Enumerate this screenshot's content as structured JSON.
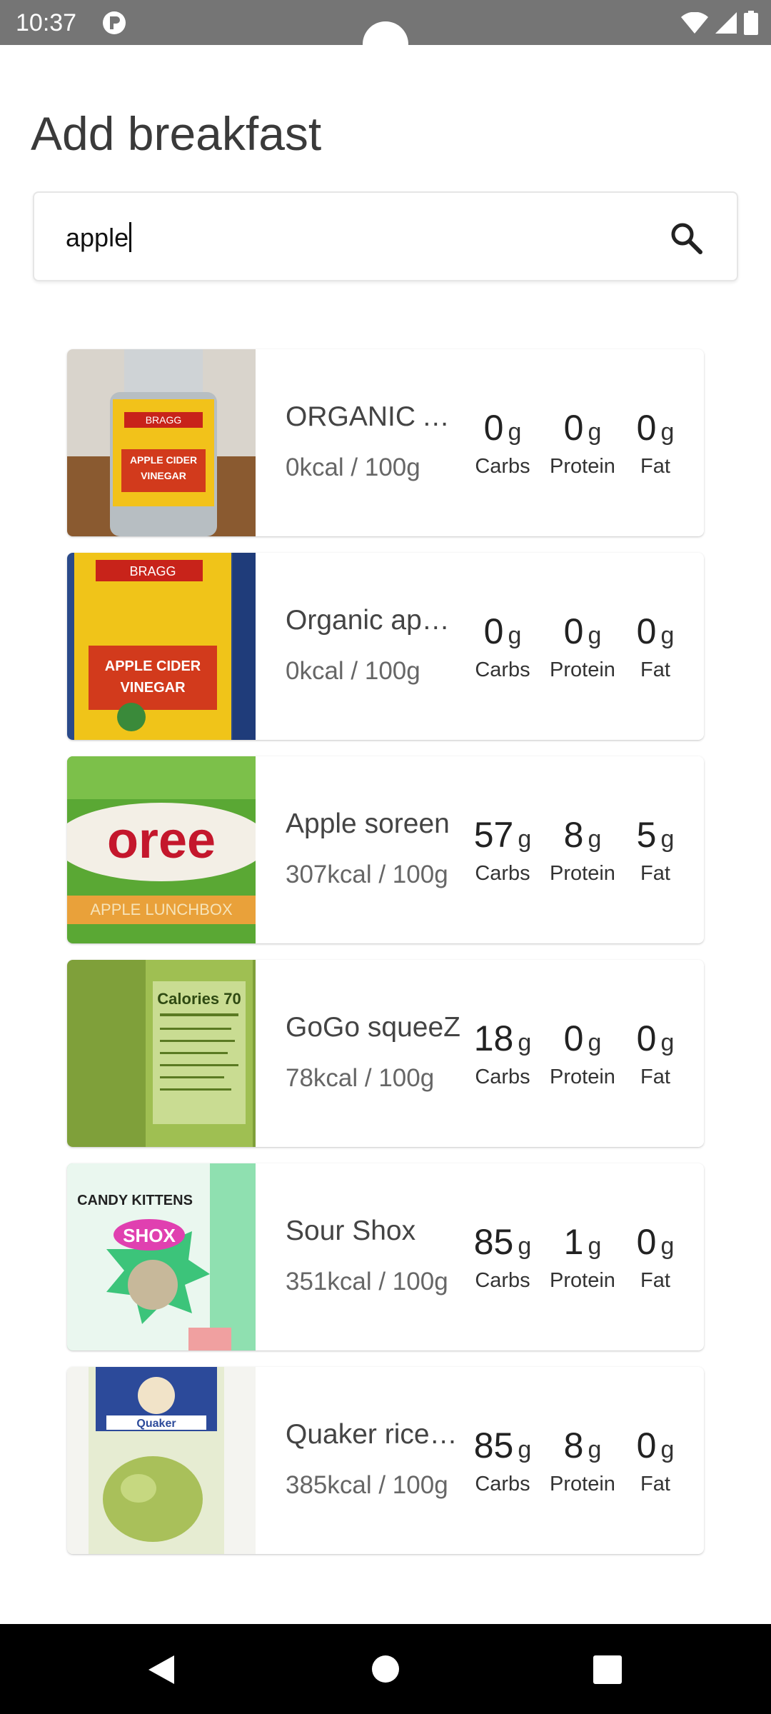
{
  "status_bar": {
    "time": "10:37"
  },
  "page": {
    "title": "Add breakfast"
  },
  "search": {
    "value": "apple"
  },
  "foods": [
    {
      "name": "ORGANIC APPLE CIDER VINEGAR",
      "kcal": "0kcal / 100g",
      "carbs": "0",
      "protein": "0",
      "fat": "0",
      "image": "braggs-apple-cider-vinegar-bottle"
    },
    {
      "name": "Organic apple cider vinegar",
      "kcal": "0kcal / 100g",
      "carbs": "0",
      "protein": "0",
      "fat": "0",
      "image": "braggs-apple-cider-vinegar-label"
    },
    {
      "name": "Apple soreen",
      "kcal": "307kcal / 100g",
      "carbs": "57",
      "protein": "8",
      "fat": "5",
      "image": "soreen-apple-lunchbox-pack"
    },
    {
      "name": "GoGo squeeZ",
      "kcal": "78kcal / 100g",
      "carbs": "18",
      "protein": "0",
      "fat": "0",
      "image": "gogo-squeez-nutrition-label"
    },
    {
      "name": "Sour Shox",
      "kcal": "351kcal / 100g",
      "carbs": "85",
      "protein": "1",
      "fat": "0",
      "image": "candy-kittens-sour-shox-pack"
    },
    {
      "name": "Quaker rice cakes",
      "kcal": "385kcal / 100g",
      "carbs": "85",
      "protein": "8",
      "fat": "0",
      "image": "quaker-rice-cakes-pack"
    }
  ],
  "labels": {
    "unit": "g",
    "carbs": "Carbs",
    "protein": "Protein",
    "fat": "Fat"
  },
  "colors": {
    "status_bar": "#757575",
    "nav_bar": "#000000",
    "card_bg": "#ffffff"
  }
}
